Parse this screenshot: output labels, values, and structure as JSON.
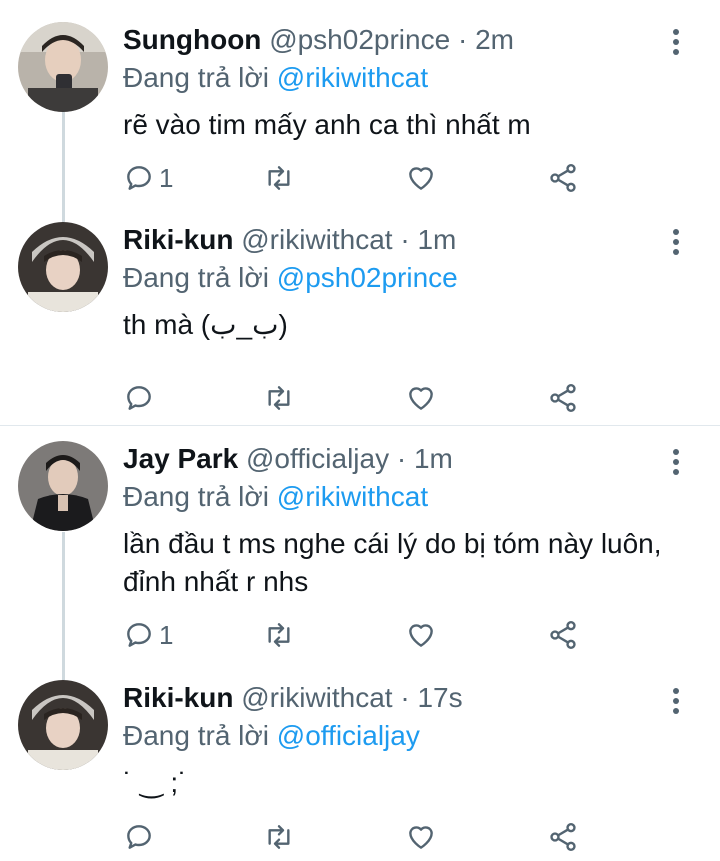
{
  "reply_prefix": "Đang trả lời",
  "tweets": [
    {
      "name": "Sunghoon",
      "handle": "@psh02prince",
      "separator": "·",
      "time": "2m",
      "reply_to": "@rikiwithcat",
      "text": "rẽ vào tim mấy anh ca thì nhất m",
      "reply_count": "1"
    },
    {
      "name": "Riki-kun",
      "handle": "@rikiwithcat",
      "separator": "·",
      "time": "1m",
      "reply_to": "@psh02prince",
      "text": "th mà (ب_ب)",
      "reply_count": ""
    },
    {
      "name": "Jay Park",
      "handle": "@officialjay",
      "separator": "·",
      "time": "1m",
      "reply_to": "@rikiwithcat",
      "text": "lần đầu t ms nghe cái lý do bị tóm này luôn, đỉnh nhất r nhs",
      "reply_count": "1"
    },
    {
      "name": "Riki-kun",
      "handle": "@rikiwithcat",
      "separator": "·",
      "time": "17s",
      "reply_to": "@officialjay",
      "text": "˙ ‿ ;˙",
      "reply_count": ""
    }
  ]
}
